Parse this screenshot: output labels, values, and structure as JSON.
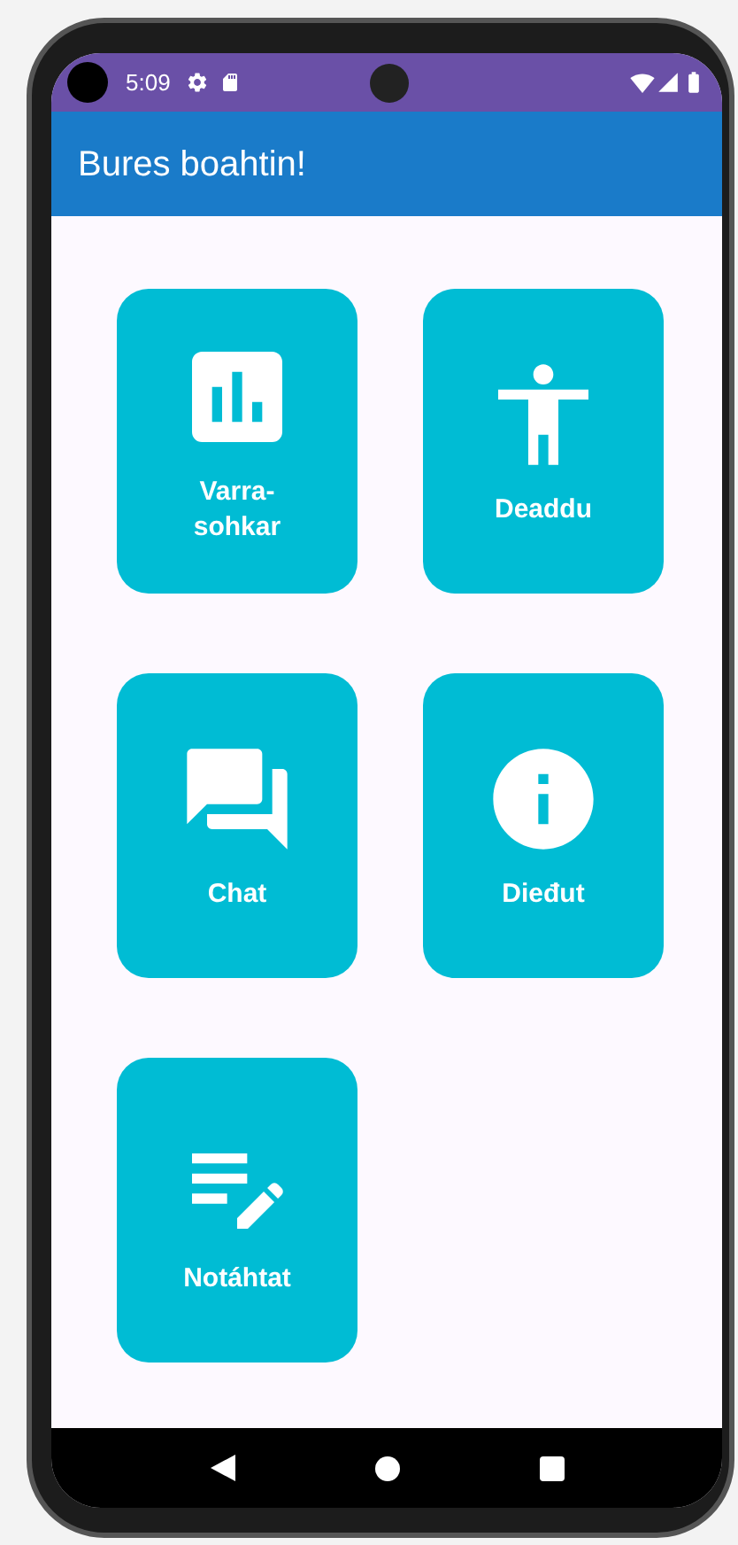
{
  "status_bar": {
    "time": "5:09"
  },
  "app_bar": {
    "title": "Bures boahtin!"
  },
  "tiles": [
    {
      "label": "Varra-sohkar"
    },
    {
      "label": "Deaddu"
    },
    {
      "label": "Chat"
    },
    {
      "label": "Dieđut"
    },
    {
      "label": "Notáhtat"
    }
  ]
}
